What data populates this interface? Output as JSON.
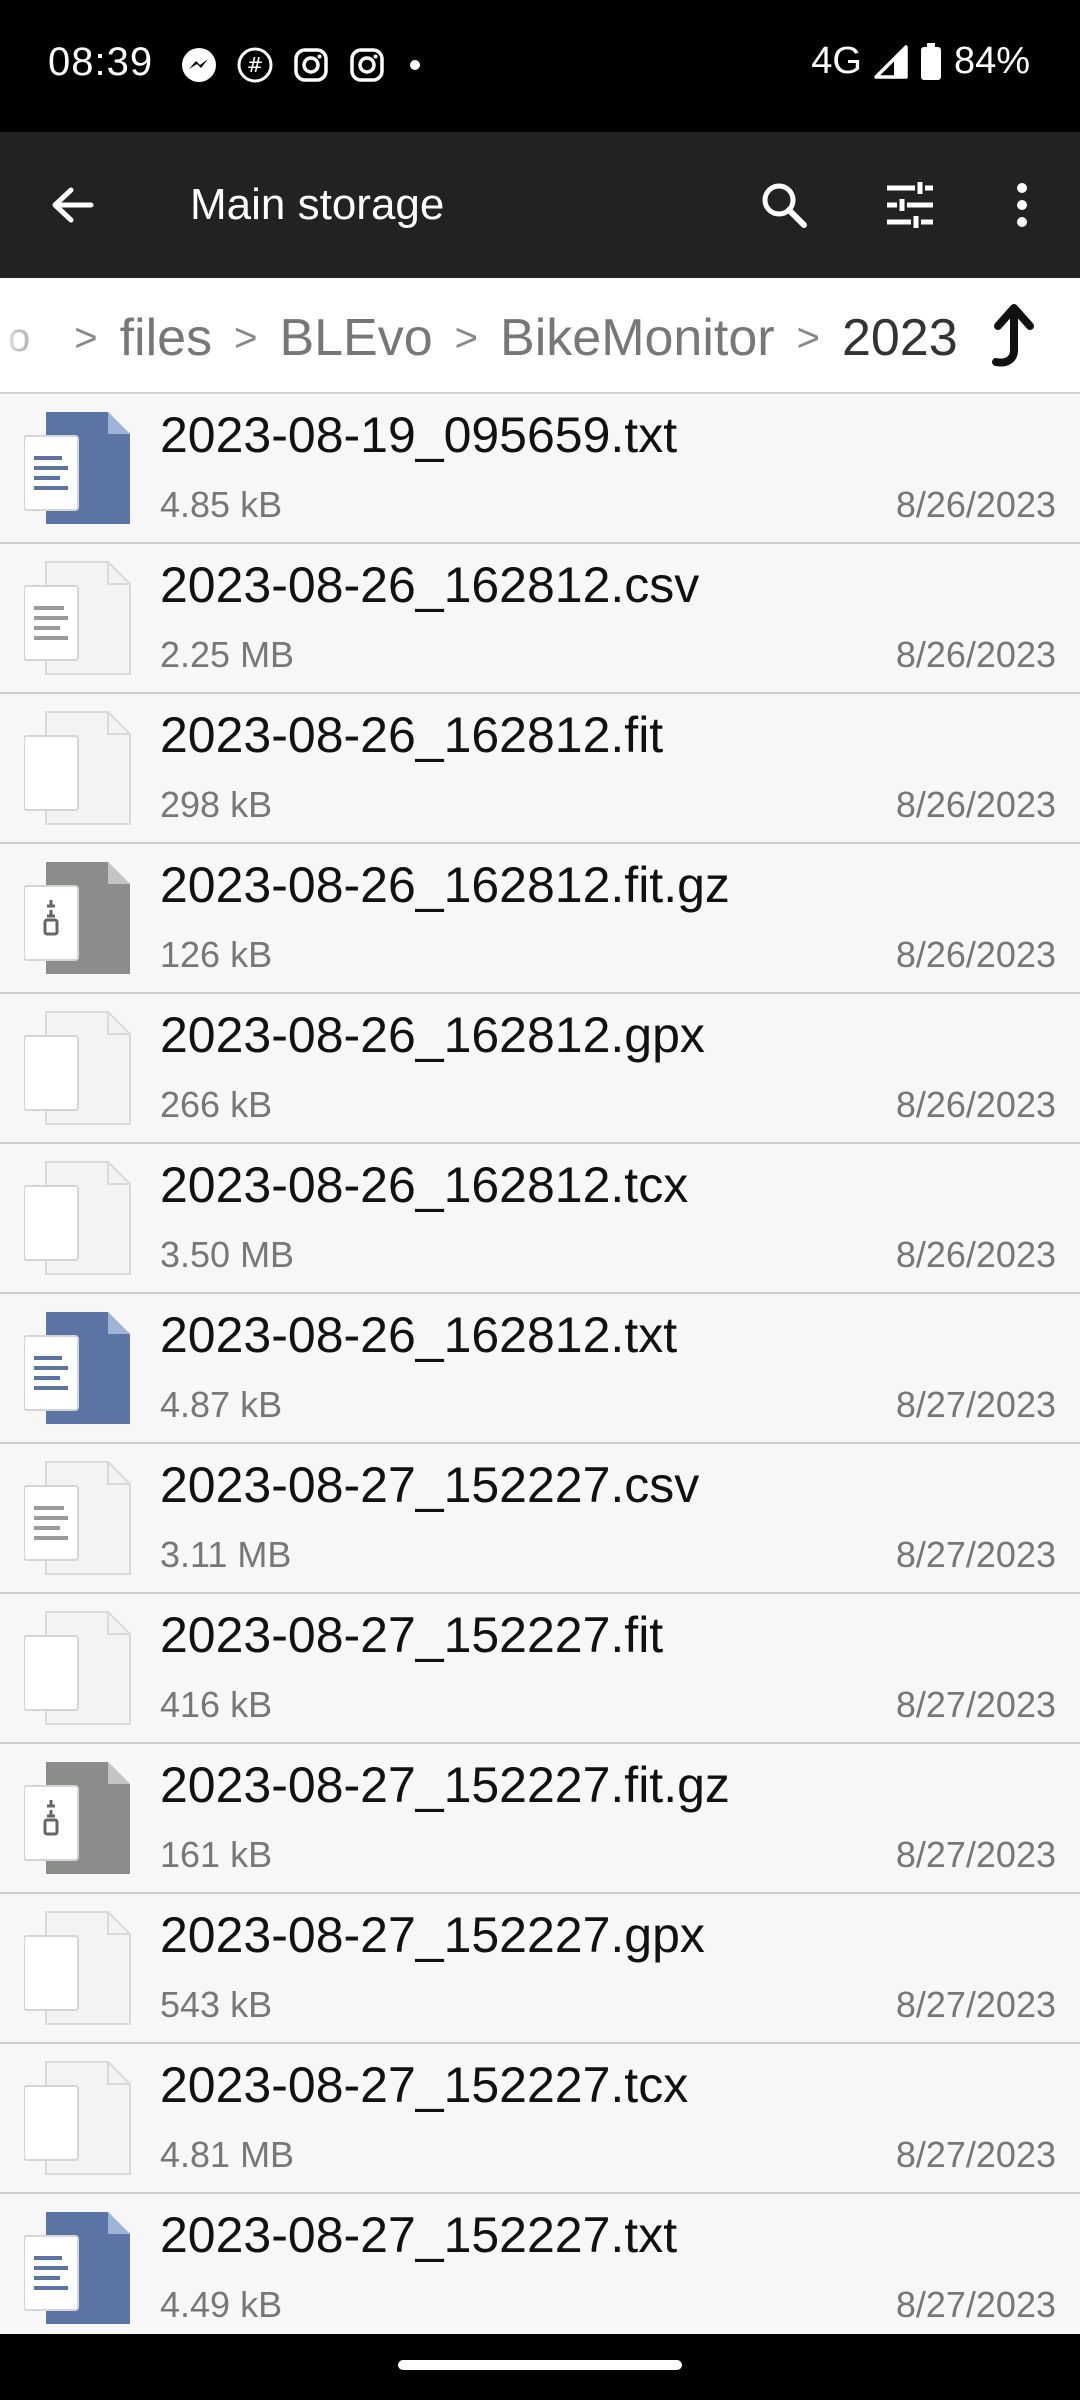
{
  "status_bar": {
    "time": "08:39",
    "left_icons": [
      "messenger-icon",
      "threads-icon",
      "instagram-icon",
      "instagram-icon",
      "dot-icon"
    ],
    "network": "4G",
    "battery": "84%"
  },
  "app_bar": {
    "title": "Main storage",
    "icons": [
      "back-arrow-icon",
      "search-icon",
      "tune-icon",
      "more-vert-icon"
    ]
  },
  "breadcrumb": {
    "items": [
      "files",
      "BLEvo",
      "BikeMonitor"
    ],
    "current": "2023",
    "up_icon": "up-arrow-icon"
  },
  "files": [
    {
      "name": "2023-08-19_095659.txt",
      "size": "4.85 kB",
      "date": "8/26/2023",
      "icon": "text-doc-icon"
    },
    {
      "name": "2023-08-26_162812.csv",
      "size": "2.25 MB",
      "date": "8/26/2023",
      "icon": "csv-doc-icon"
    },
    {
      "name": "2023-08-26_162812.fit",
      "size": "298 kB",
      "date": "8/26/2023",
      "icon": "blank-file-icon"
    },
    {
      "name": "2023-08-26_162812.fit.gz",
      "size": "126 kB",
      "date": "8/26/2023",
      "icon": "archive-icon"
    },
    {
      "name": "2023-08-26_162812.gpx",
      "size": "266 kB",
      "date": "8/26/2023",
      "icon": "blank-file-icon"
    },
    {
      "name": "2023-08-26_162812.tcx",
      "size": "3.50 MB",
      "date": "8/26/2023",
      "icon": "blank-file-icon"
    },
    {
      "name": "2023-08-26_162812.txt",
      "size": "4.87 kB",
      "date": "8/27/2023",
      "icon": "text-doc-icon"
    },
    {
      "name": "2023-08-27_152227.csv",
      "size": "3.11 MB",
      "date": "8/27/2023",
      "icon": "csv-doc-icon"
    },
    {
      "name": "2023-08-27_152227.fit",
      "size": "416 kB",
      "date": "8/27/2023",
      "icon": "blank-file-icon"
    },
    {
      "name": "2023-08-27_152227.fit.gz",
      "size": "161 kB",
      "date": "8/27/2023",
      "icon": "archive-icon"
    },
    {
      "name": "2023-08-27_152227.gpx",
      "size": "543 kB",
      "date": "8/27/2023",
      "icon": "blank-file-icon"
    },
    {
      "name": "2023-08-27_152227.tcx",
      "size": "4.81 MB",
      "date": "8/27/2023",
      "icon": "blank-file-icon"
    },
    {
      "name": "2023-08-27_152227.txt",
      "size": "4.49 kB",
      "date": "8/27/2023",
      "icon": "text-doc-icon"
    }
  ],
  "colors": {
    "status_bg": "#000000",
    "app_bar_bg": "#222222",
    "list_bg": "#f7f7f7",
    "text_doc_blue": "#5b74a4",
    "archive_gray": "#8a8d8a"
  }
}
